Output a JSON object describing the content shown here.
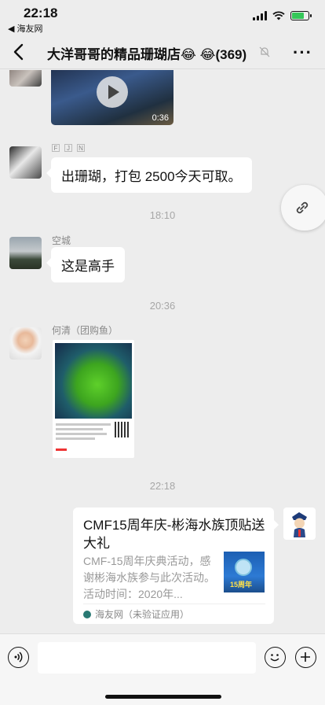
{
  "status_bar": {
    "time": "22:18",
    "back_app": "◀ 海友网",
    "battery_color": "#35c759"
  },
  "nav": {
    "title": "大洋哥哥的精品珊瑚店😂 😂(369)",
    "back_icon": "chevron-left-icon",
    "mute_icon": "bell-off-icon",
    "more_icon": "more-dots-icon"
  },
  "messages": {
    "video": {
      "duration": "0:36"
    },
    "coral_msg": {
      "tags": [
        "F",
        "J",
        "N"
      ],
      "text": "出珊瑚，打包 2500今天可取。"
    },
    "time_1": "18:10",
    "kongcheng": {
      "sender": "空城",
      "text": "这是高手"
    },
    "time_2": "20:36",
    "heqing": {
      "sender": "何清（团购鱼）"
    },
    "time_3": "22:18",
    "share_card": {
      "title": "CMF15周年庆-彬海水族顶贴送大礼",
      "description": "CMF-15周年庆典活动，感谢彬海水族参与此次活动。活动时间：2020年...",
      "source": "海友网（未验证应用）",
      "thumb_text": "15周年"
    }
  },
  "input_bar": {
    "placeholder": "",
    "voice_icon": "voice-icon",
    "emoji_icon": "emoji-icon",
    "plus_icon": "plus-icon"
  },
  "link_icon": "link-icon"
}
